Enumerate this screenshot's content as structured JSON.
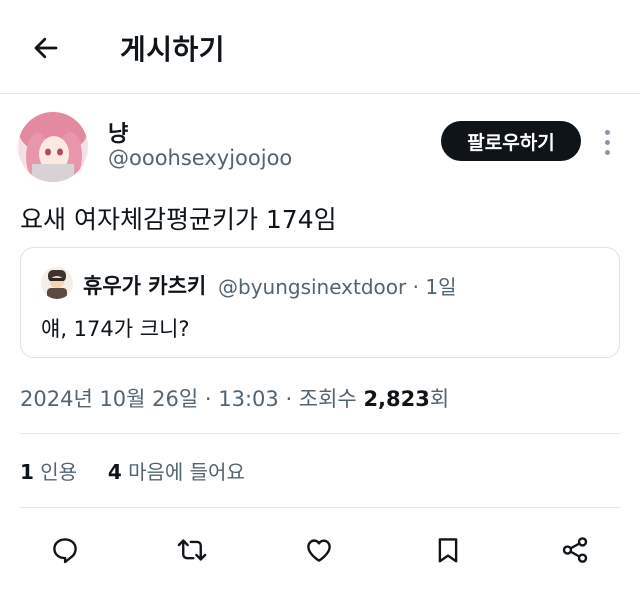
{
  "header": {
    "title": "게시하기",
    "back_icon": "arrow-left-icon"
  },
  "author": {
    "display_name": "냥",
    "handle": "@ooohsexyjoojoo",
    "follow_label": "팔로우하기",
    "more_icon": "more-vertical-icon"
  },
  "tweet": {
    "text": "요새 여자체감평균키가 174임"
  },
  "quote": {
    "name": "휴우가 카츠키",
    "handle": "@byungsinextdoor",
    "separator": " · ",
    "time": "1일",
    "text": "얘, 174가 크니?"
  },
  "meta": {
    "date": "2024년 10월 26일",
    "sep1": " · ",
    "time": "13:03",
    "sep2": " · ",
    "views_label": "조회수 ",
    "views_count": "2,823",
    "views_suffix": "회"
  },
  "stats": {
    "quotes_count": "1",
    "quotes_label": " 인용",
    "likes_count": "4",
    "likes_label": " 마음에 들어요"
  },
  "actions": [
    "reply-icon",
    "retweet-icon",
    "like-icon",
    "bookmark-icon",
    "share-icon"
  ],
  "colors": {
    "text": "#0f1419",
    "secondary": "#536471",
    "border": "#e6e9eb",
    "follow_bg": "#0f1419"
  }
}
